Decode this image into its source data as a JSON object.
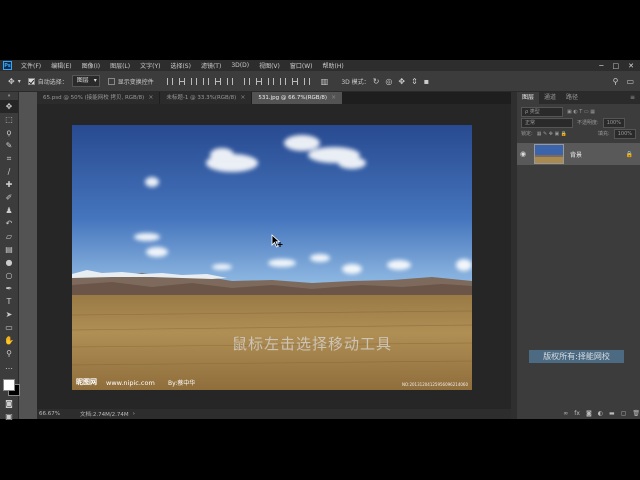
{
  "app": {
    "logo": "Ps"
  },
  "menu": [
    "文件(F)",
    "编辑(E)",
    "图像(I)",
    "图层(L)",
    "文字(Y)",
    "选择(S)",
    "滤镜(T)",
    "3D(D)",
    "视图(V)",
    "窗口(W)",
    "帮助(H)"
  ],
  "window_controls": {
    "minimize": "─",
    "maximize": "□",
    "close": "✕"
  },
  "options": {
    "move_icon": "move-tool-icon",
    "auto_select_label": "自动选择：",
    "auto_select_checked": true,
    "auto_select_value": "图层",
    "show_transform_label": "显示变换控件",
    "show_transform_checked": false,
    "mode_3d_label": "3D 模式："
  },
  "tabs": [
    {
      "label": "65.psd @ 50% (接能网校 拷贝, RGB/8)",
      "active": false
    },
    {
      "label": "未标题-1 @ 33.3%(RGB/8)",
      "active": false
    },
    {
      "label": "531.jpg @ 66.7%(RGB/8)",
      "active": true
    }
  ],
  "photo": {
    "watermark_logo": "昵图网",
    "watermark_url": "www.nipic.com",
    "watermark_author": "By:蔡中华",
    "watermark_id": "NO:20131204125956096214060"
  },
  "caption": "鼠标左击选择移动工具",
  "status": {
    "zoom": "66.67%",
    "doc_size": "文档:2.74M/2.74M"
  },
  "panel": {
    "tabs": [
      "图层",
      "通道",
      "路径"
    ],
    "search_placeholder": "ρ 类型",
    "blend_mode": "正常",
    "opacity_label": "不透明度:",
    "opacity_value": "100%",
    "lock_label": "锁定:",
    "fill_label": "填充:",
    "fill_value": "100%",
    "layer_name": "背景",
    "watermark": "版权所有:择能网校"
  },
  "colors": {
    "fg": "#ffffff",
    "bg": "#000000",
    "sky_top": "#2c4e94",
    "sky_bottom": "#86b5e3",
    "ground": "#a98a4f"
  }
}
